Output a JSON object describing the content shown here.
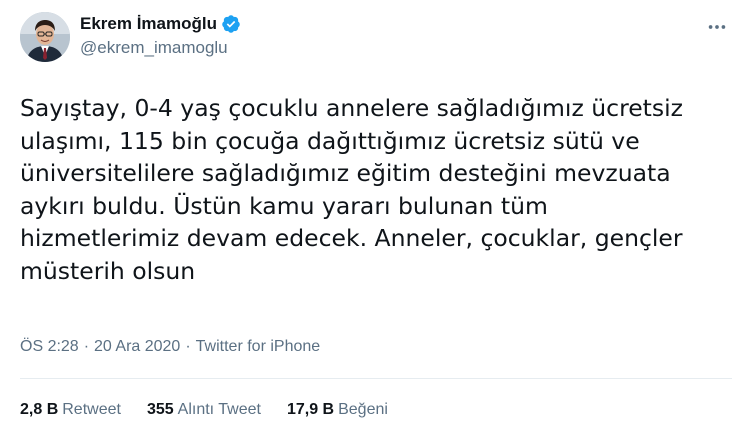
{
  "author": {
    "display_name": "Ekrem İmamoğlu",
    "handle": "@ekrem_imamoglu",
    "verified": true,
    "verified_color": "#1da1f2"
  },
  "tweet": {
    "lines": [
      "Sayıştay, 0-4 yaş çocuklu annelere sağladığımız ücretsiz",
      "ulaşımı, 115 bin çocuğa dağıttığımız ücretsiz sütü ve",
      "üniversitelilere sağladığımız eğitim desteğini mevzuata",
      "aykırı buldu. Üstün kamu yararı bulunan tüm",
      "hizmetlerimiz devam edecek. Anneler, çocuklar, gençler",
      "müsterih olsun"
    ]
  },
  "meta": {
    "time": "ÖS 2:28",
    "separator": "·",
    "date": "20 Ara 2020",
    "source": "Twitter for iPhone"
  },
  "stats": {
    "retweets_count": "2,8 B",
    "retweets_label": "Retweet",
    "quotes_count": "355",
    "quotes_label": "Alıntı Tweet",
    "likes_count": "17,9 B",
    "likes_label": "Beğeni"
  },
  "icons": {
    "more": "more-options-icon",
    "verified": "verified-badge-icon"
  },
  "colors": {
    "text": "#0f1419",
    "secondary": "#5b7083",
    "divider": "#e6ecf0",
    "accent": "#1da1f2"
  }
}
